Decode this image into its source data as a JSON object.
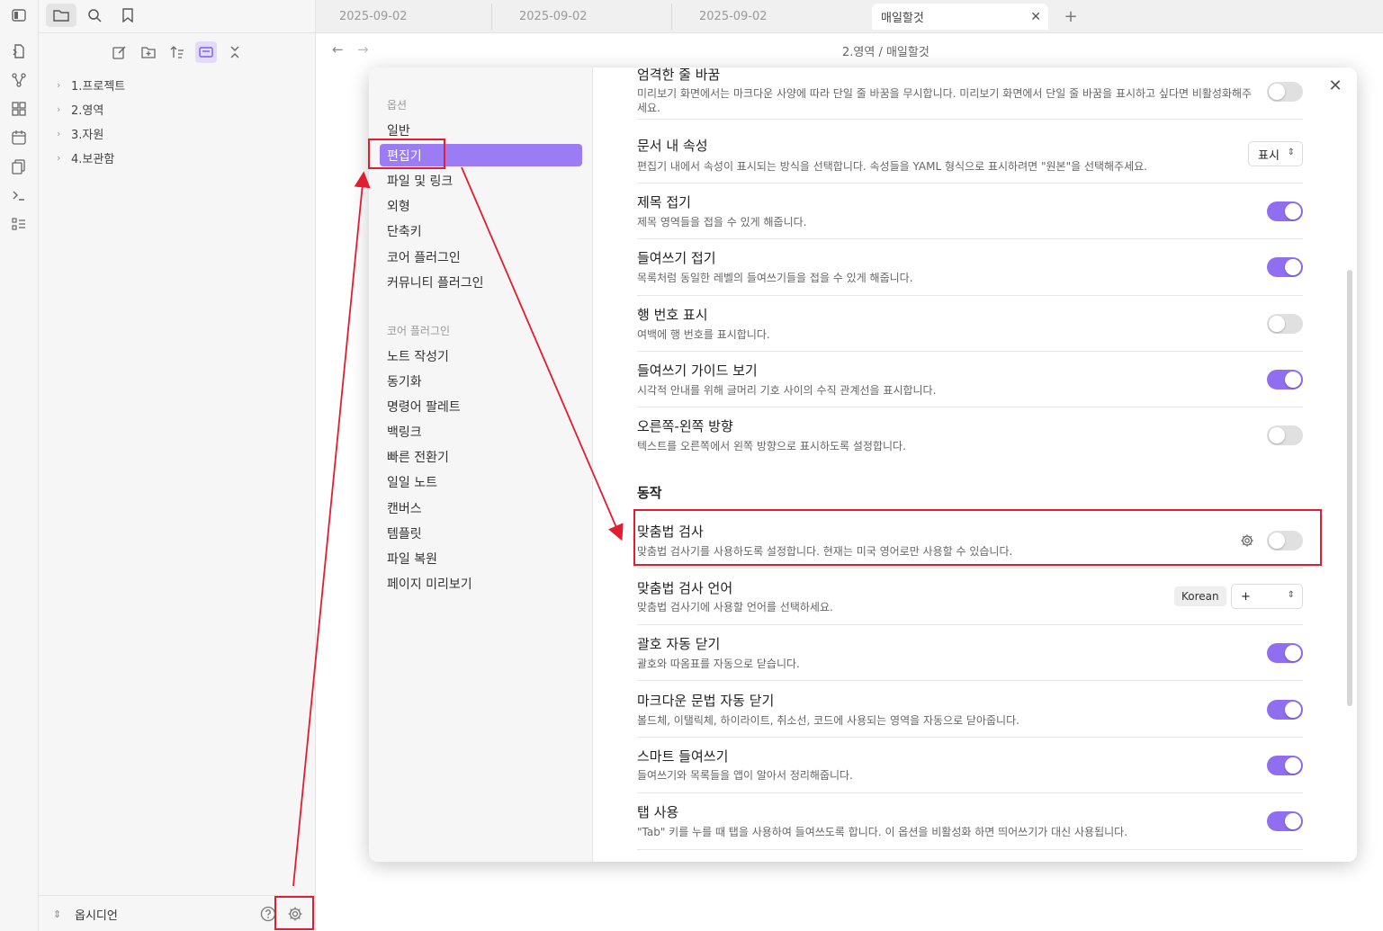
{
  "ribbon": {
    "icons": [
      "sidebar-toggle-icon",
      "open-quick-switcher-icon",
      "graph-view-icon",
      "canvas-icon",
      "daily-note-icon",
      "templates-icon",
      "terminal-icon",
      "bookmarks-list-icon"
    ]
  },
  "sidebar": {
    "top_tabs": [
      "folder-icon",
      "search-icon",
      "bookmark-icon"
    ],
    "nav_tools": [
      "new-note-icon",
      "new-folder-icon",
      "sort-icon",
      "auto-reveal-icon",
      "collapse-all-icon"
    ],
    "tree": [
      "1.프로젝트",
      "2.영역",
      "3.자원",
      "4.보관함"
    ],
    "vault_name": "옵시디언"
  },
  "tabs": [
    {
      "label": "2025-09-02"
    },
    {
      "label": "2025-09-02"
    },
    {
      "label": "2025-09-02"
    },
    {
      "label": "매일할것"
    }
  ],
  "breadcrumb": "2.영역 / 매일할것",
  "settings": {
    "nav_header_options": "옵션",
    "nav_options": [
      "일반",
      "편집기",
      "파일 및 링크",
      "외형",
      "단축키",
      "코어 플러그인",
      "커뮤니티 플러그인"
    ],
    "nav_header_core": "코어 플러그인",
    "nav_core": [
      "노트 작성기",
      "동기화",
      "명령어 팔레트",
      "백링크",
      "빠른 전환기",
      "일일 노트",
      "캔버스",
      "템플릿",
      "파일 복원",
      "페이지 미리보기"
    ],
    "active_nav": "편집기",
    "items": [
      {
        "name": "엄격한 줄 바꿈",
        "desc": "미리보기 화면에서는 마크다운 사양에 따라 단일 줄 바꿈을 무시합니다. 미리보기 화면에서 단일 줄 바꿈을 표시하고 싶다면 비활성화해주세요.",
        "on": false
      },
      {
        "name": "문서 내 속성",
        "desc": "편집기 내에서 속성이 표시되는 방식을 선택합니다. 속성들을 YAML 형식으로 표시하려면 \"원본\"을 선택해주세요.",
        "select": "표시"
      },
      {
        "name": "제목 접기",
        "desc": "제목 영역들을 접을 수 있게 해줍니다.",
        "on": true
      },
      {
        "name": "들여쓰기 접기",
        "desc": "목록처럼 동일한 레벨의 들여쓰기들을 접을 수 있게 해줍니다.",
        "on": true
      },
      {
        "name": "행 번호 표시",
        "desc": "여백에 행 번호를 표시합니다.",
        "on": false
      },
      {
        "name": "들여쓰기 가이드 보기",
        "desc": "시각적 안내를 위해 글머리 기호 사이의 수직 관계선을 표시합니다.",
        "on": true
      },
      {
        "name": "오른쪽-왼쪽 방향",
        "desc": "텍스트를 오른쪽에서 왼쪽 방향으로 표시하도록 설정합니다.",
        "on": false
      }
    ],
    "section_behavior": "동작",
    "behavior_items": [
      {
        "name": "맞춤법 검사",
        "desc": "맞춤법 검사기를 사용하도록 설정합니다. 현재는 미국 영어로만 사용할 수 있습니다.",
        "on": false
      },
      {
        "name": "맞춤법 검사 언어",
        "desc": "맞춤법 검사기에 사용할 언어를 선택하세요.",
        "lang_tag": "Korean",
        "select": "+"
      },
      {
        "name": "괄호 자동 닫기",
        "desc": "괄호와 따옴표를 자동으로 닫습니다.",
        "on": true
      },
      {
        "name": "마크다운 문법 자동 닫기",
        "desc": "볼드체, 이탤릭체, 하이라이트, 취소선, 코드에 사용되는 영역을 자동으로 닫아줍니다.",
        "on": true
      },
      {
        "name": "스마트 들여쓰기",
        "desc": "들여쓰기와 목록들을 앱이 알아서 정리해줍니다.",
        "on": true
      },
      {
        "name": "탭 사용",
        "desc": "\"Tab\" 키를 누를 때 탭을 사용하여 들여쓰도록 합니다. 이 옵션을 비활성화 하면 띄어쓰기가 대신 사용됩니다.",
        "on": true
      }
    ]
  },
  "colors": {
    "accent": "#8f6ff0",
    "annotation": "#e11d32"
  }
}
